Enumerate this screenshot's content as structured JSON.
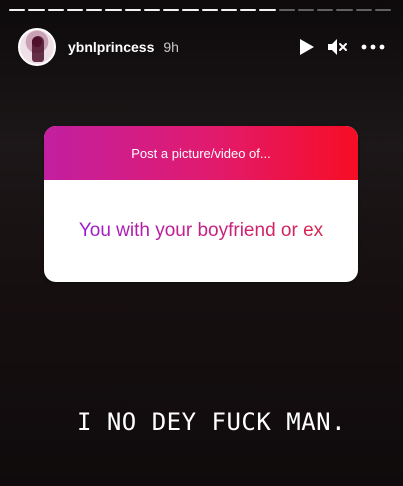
{
  "story": {
    "progress_segments": 20,
    "active_segments": 14
  },
  "header": {
    "username": "ybnlprincess",
    "time": "9h",
    "icons": [
      "play-icon",
      "mute-icon",
      "more-options-icon"
    ]
  },
  "question_sticker": {
    "prompt": "Post a picture/video of...",
    "answer": "You with your boyfriend or ex",
    "colors": {
      "head_start": "#c21fa0",
      "head_end": "#f70d24"
    }
  },
  "caption": "I NO DEY FUCK MAN."
}
